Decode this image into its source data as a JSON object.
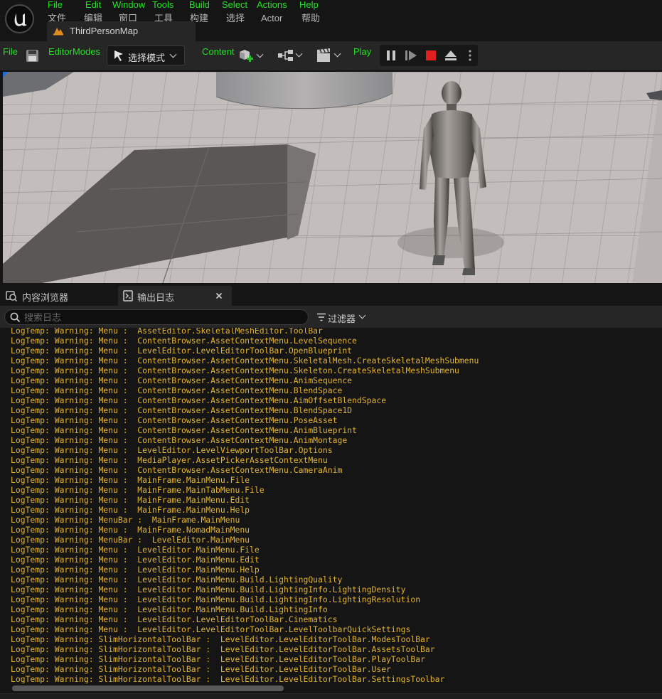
{
  "window": {
    "map_tab": "ThirdPersonMap"
  },
  "menu": [
    {
      "en": "File",
      "zh": "文件"
    },
    {
      "en": "Edit",
      "zh": "编辑"
    },
    {
      "en": "Window",
      "zh": "窗口"
    },
    {
      "en": "Tools",
      "zh": "工具"
    },
    {
      "en": "Build",
      "zh": "构建"
    },
    {
      "en": "Select",
      "zh": "选择"
    },
    {
      "en": "Actions",
      "zh": "Actor"
    },
    {
      "en": "Help",
      "zh": "帮助"
    }
  ],
  "toolbar": {
    "file_label": "File",
    "editor_modes_label": "EditorModes",
    "mode_select": "选择模式",
    "content_label": "Content",
    "play_label": "Play"
  },
  "icons": [
    "unreal-logo-icon",
    "map-tab-icon",
    "save-icon",
    "select-mode-icon",
    "add-actor-icon",
    "blueprint-icon",
    "cinematics-icon",
    "pause-icon",
    "step-icon",
    "stop-icon",
    "eject-icon",
    "more-options-icon",
    "content-browser-icon",
    "output-log-icon",
    "close-icon",
    "search-icon",
    "filter-icon",
    "chevron-down-icon"
  ],
  "panel": {
    "tab_content_browser": "内容浏览器",
    "tab_output_log": "输出日志",
    "search_placeholder": "搜索日志",
    "filter_label": "过滤器"
  },
  "colors": {
    "green_label": "#22e022",
    "log_warning": "#e3b431",
    "stop": "#e02020"
  },
  "log_lines": [
    "LogTemp: Warning: Menu :  AssetEditor.SkeletalMeshEditor.ToolBar",
    "LogTemp: Warning: Menu :  ContentBrowser.AssetContextMenu.LevelSequence",
    "LogTemp: Warning: Menu :  LevelEditor.LevelEditorToolBar.OpenBlueprint",
    "LogTemp: Warning: Menu :  ContentBrowser.AssetContextMenu.SkeletalMesh.CreateSkeletalMeshSubmenu",
    "LogTemp: Warning: Menu :  ContentBrowser.AssetContextMenu.Skeleton.CreateSkeletalMeshSubmenu",
    "LogTemp: Warning: Menu :  ContentBrowser.AssetContextMenu.AnimSequence",
    "LogTemp: Warning: Menu :  ContentBrowser.AssetContextMenu.BlendSpace",
    "LogTemp: Warning: Menu :  ContentBrowser.AssetContextMenu.AimOffsetBlendSpace",
    "LogTemp: Warning: Menu :  ContentBrowser.AssetContextMenu.BlendSpace1D",
    "LogTemp: Warning: Menu :  ContentBrowser.AssetContextMenu.PoseAsset",
    "LogTemp: Warning: Menu :  ContentBrowser.AssetContextMenu.AnimBlueprint",
    "LogTemp: Warning: Menu :  ContentBrowser.AssetContextMenu.AnimMontage",
    "LogTemp: Warning: Menu :  LevelEditor.LevelViewportToolBar.Options",
    "LogTemp: Warning: Menu :  MediaPlayer.AssetPickerAssetContextMenu",
    "LogTemp: Warning: Menu :  ContentBrowser.AssetContextMenu.CameraAnim",
    "LogTemp: Warning: Menu :  MainFrame.MainMenu.File",
    "LogTemp: Warning: Menu :  MainFrame.MainTabMenu.File",
    "LogTemp: Warning: Menu :  MainFrame.MainMenu.Edit",
    "LogTemp: Warning: Menu :  MainFrame.MainMenu.Help",
    "LogTemp: Warning: MenuBar :  MainFrame.MainMenu",
    "LogTemp: Warning: Menu :  MainFrame.NomadMainMenu",
    "LogTemp: Warning: MenuBar :  LevelEditor.MainMenu",
    "LogTemp: Warning: Menu :  LevelEditor.MainMenu.File",
    "LogTemp: Warning: Menu :  LevelEditor.MainMenu.Edit",
    "LogTemp: Warning: Menu :  LevelEditor.MainMenu.Help",
    "LogTemp: Warning: Menu :  LevelEditor.MainMenu.Build.LightingQuality",
    "LogTemp: Warning: Menu :  LevelEditor.MainMenu.Build.LightingInfo.LightingDensity",
    "LogTemp: Warning: Menu :  LevelEditor.MainMenu.Build.LightingInfo.LightingResolution",
    "LogTemp: Warning: Menu :  LevelEditor.MainMenu.Build.LightingInfo",
    "LogTemp: Warning: Menu :  LevelEditor.LevelEditorToolBar.Cinematics",
    "LogTemp: Warning: Menu :  LevelEditor.LevelEditorToolBar.LevelToolbarQuickSettings",
    "LogTemp: Warning: SlimHorizontalToolBar :  LevelEditor.LevelEditorToolBar.ModesToolBar",
    "LogTemp: Warning: SlimHorizontalToolBar :  LevelEditor.LevelEditorToolBar.AssetsToolBar",
    "LogTemp: Warning: SlimHorizontalToolBar :  LevelEditor.LevelEditorToolBar.PlayToolBar",
    "LogTemp: Warning: SlimHorizontalToolBar :  LevelEditor.LevelEditorToolBar.User",
    "LogTemp: Warning: SlimHorizontalToolBar :  LevelEditor.LevelEditorToolBar.SettingsToolbar"
  ]
}
